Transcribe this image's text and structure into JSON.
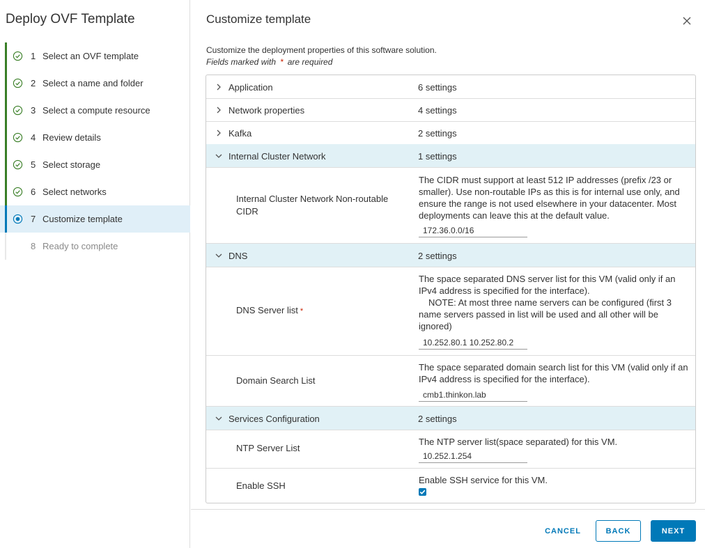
{
  "sidebar": {
    "title": "Deploy OVF Template",
    "steps": [
      {
        "num": "1",
        "label": "Select an OVF template",
        "state": "done"
      },
      {
        "num": "2",
        "label": "Select a name and folder",
        "state": "done"
      },
      {
        "num": "3",
        "label": "Select a compute resource",
        "state": "done"
      },
      {
        "num": "4",
        "label": "Review details",
        "state": "done"
      },
      {
        "num": "5",
        "label": "Select storage",
        "state": "done"
      },
      {
        "num": "6",
        "label": "Select networks",
        "state": "done"
      },
      {
        "num": "7",
        "label": "Customize template",
        "state": "current"
      },
      {
        "num": "8",
        "label": "Ready to complete",
        "state": "pending"
      }
    ]
  },
  "main": {
    "title": "Customize template",
    "description": "Customize the deployment properties of this software solution.",
    "required_note_before": "Fields marked with",
    "required_star": "*",
    "required_note_after": "are required",
    "groups": {
      "application": {
        "label": "Application",
        "count": "6 settings"
      },
      "network": {
        "label": "Network properties",
        "count": "4 settings"
      },
      "kafka": {
        "label": "Kafka",
        "count": "2 settings"
      },
      "internal": {
        "label": "Internal Cluster Network",
        "count": "1 settings"
      },
      "dns": {
        "label": "DNS",
        "count": "2 settings"
      },
      "services": {
        "label": "Services Configuration",
        "count": "2 settings"
      }
    },
    "props": {
      "cidr": {
        "name": "Internal Cluster Network Non-routable CIDR",
        "desc": "The CIDR must support at least 512 IP addresses (prefix /23 or smaller). Use non-routable IPs as this is for internal use only, and ensure the range is not used elsewhere in your datacenter. Most deployments can leave this at the default value.",
        "value": "172.36.0.0/16"
      },
      "dns_servers": {
        "name": "DNS Server list",
        "required": "*",
        "desc_line1": "The space separated DNS server list for this VM (valid only if an IPv4 address is specified for the interface).",
        "desc_line2": "NOTE: At most three name servers can be configured (first 3 name servers passed in list will be used and all other will be ignored)",
        "value": "10.252.80.1 10.252.80.2"
      },
      "domain_search": {
        "name": "Domain Search List",
        "desc": "The space separated domain search list for this VM (valid only if an IPv4 address is specified for the interface).",
        "value": "cmb1.thinkon.lab"
      },
      "ntp": {
        "name": "NTP Server List",
        "desc": "The NTP server list(space separated) for this VM.",
        "value": "10.252.1.254"
      },
      "ssh": {
        "name": "Enable SSH",
        "desc": "Enable SSH service for this VM.",
        "checked": true
      }
    }
  },
  "footer": {
    "cancel_label": "CANCEL",
    "back_label": "BACK",
    "next_label": "NEXT"
  },
  "icons": {
    "done": "check-circle-icon",
    "current": "radio-dot-icon",
    "close": "close-icon",
    "collapsed": "chevron-right-icon",
    "expanded": "chevron-down-icon"
  },
  "colors": {
    "done_green": "#3a7f27",
    "accent_blue": "#0079b8",
    "current_step_bg": "#e0eff8",
    "expanded_group_bg": "#e1f1f6",
    "required_red": "#c92100"
  }
}
